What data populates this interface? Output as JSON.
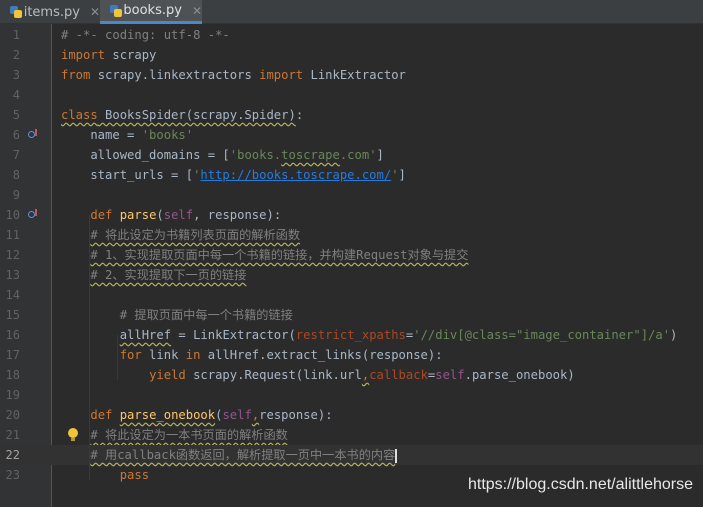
{
  "tabs": [
    {
      "label": "items.py",
      "active": false
    },
    {
      "label": "books.py",
      "active": true
    }
  ],
  "close_glyph": "✕",
  "line_numbers": [
    "1",
    "2",
    "3",
    "4",
    "5",
    "6",
    "7",
    "8",
    "9",
    "10",
    "11",
    "12",
    "13",
    "14",
    "15",
    "16",
    "17",
    "18",
    "19",
    "20",
    "21",
    "22",
    "23"
  ],
  "current_line": "22",
  "code_lines": [
    [
      [
        "cm",
        "# -*- coding: utf-8 -*-"
      ]
    ],
    [
      [
        "kw",
        "import"
      ],
      [
        "",
        " scrapy"
      ]
    ],
    [
      [
        "kw",
        "from"
      ],
      [
        "",
        " scrapy.linkextractors "
      ],
      [
        "kw",
        "import"
      ],
      [
        "",
        " LinkExtractor"
      ]
    ],
    [],
    [
      [
        "kw sq",
        "class"
      ],
      [
        "sq",
        " BooksSpider(scrapy.Spider)"
      ],
      [
        "",
        ":"
      ]
    ],
    [
      [
        "",
        "    name = "
      ],
      [
        "str",
        "'books'"
      ]
    ],
    [
      [
        "",
        "    allowed_domains = ["
      ],
      [
        "str",
        "'books."
      ],
      [
        "str sq",
        "toscrape"
      ],
      [
        "str",
        ".com'"
      ],
      [
        "",
        "]"
      ]
    ],
    [
      [
        "",
        "    start_urls = ["
      ],
      [
        "str",
        "'"
      ],
      [
        "url",
        "http://books.toscrape.com/"
      ],
      [
        "str",
        "'"
      ],
      [
        "",
        "]"
      ]
    ],
    [],
    [
      [
        "",
        "    "
      ],
      [
        "kw",
        "def"
      ],
      [
        "",
        " "
      ],
      [
        "fn",
        "parse"
      ],
      [
        "",
        "("
      ],
      [
        "self",
        "self"
      ],
      [
        "",
        ", response):"
      ]
    ],
    [
      [
        "",
        "    "
      ],
      [
        "cm sq",
        "# 将此设定为书籍列表页面的解析函数"
      ]
    ],
    [
      [
        "",
        "    "
      ],
      [
        "cm sq",
        "# 1、实现提取页面中每一个书籍的链接，并构建Request对象与提交"
      ]
    ],
    [
      [
        "",
        "    "
      ],
      [
        "cm sq",
        "# 2、实现提取下一页的链接"
      ]
    ],
    [],
    [
      [
        "",
        "        "
      ],
      [
        "cm",
        "# 提取页面中每一个书籍的链接"
      ]
    ],
    [
      [
        "",
        "        "
      ],
      [
        "sq",
        "allHref"
      ],
      [
        "",
        " = LinkExtractor("
      ],
      [
        "param",
        "restrict_xpaths"
      ],
      [
        "",
        "="
      ],
      [
        "str",
        "'//div[@class=\"image_container\"]/a'"
      ],
      [
        "",
        ")"
      ]
    ],
    [
      [
        "",
        "        "
      ],
      [
        "kw",
        "for"
      ],
      [
        "",
        " link "
      ],
      [
        "kw",
        "in"
      ],
      [
        "",
        " allHref.extract_links(response):"
      ]
    ],
    [
      [
        "",
        "            "
      ],
      [
        "kw",
        "yield"
      ],
      [
        "",
        " scrapy.Request(link.url"
      ],
      [
        "kw sq",
        ","
      ],
      [
        "param",
        "callback"
      ],
      [
        "",
        "="
      ],
      [
        "self",
        "self"
      ],
      [
        "",
        ".parse_onebook)"
      ]
    ],
    [],
    [
      [
        "",
        "    "
      ],
      [
        "kw",
        "def"
      ],
      [
        "",
        " "
      ],
      [
        "fn sq",
        "parse_onebook"
      ],
      [
        "",
        "("
      ],
      [
        "self",
        "self"
      ],
      [
        "kw sq",
        ","
      ],
      [
        "",
        "response):"
      ]
    ],
    [
      [
        "",
        "    "
      ],
      [
        "cm sq",
        "# 将此设定为一本书页面的解析函数"
      ]
    ],
    [
      [
        "",
        "    "
      ],
      [
        "cm sq",
        "# 用callback函数返回，解析提取一页中一本书的内容"
      ],
      [
        "caret",
        ""
      ]
    ],
    [
      [
        "",
        "        "
      ],
      [
        "kw",
        "pass"
      ]
    ]
  ],
  "gutter_icons": [
    {
      "line": "6",
      "name": "override-icon"
    },
    {
      "line": "10",
      "name": "override-icon"
    },
    {
      "line": "21",
      "name": "intention-bulb-icon"
    }
  ],
  "watermark": "https://blog.csdn.net/alittlehorse"
}
